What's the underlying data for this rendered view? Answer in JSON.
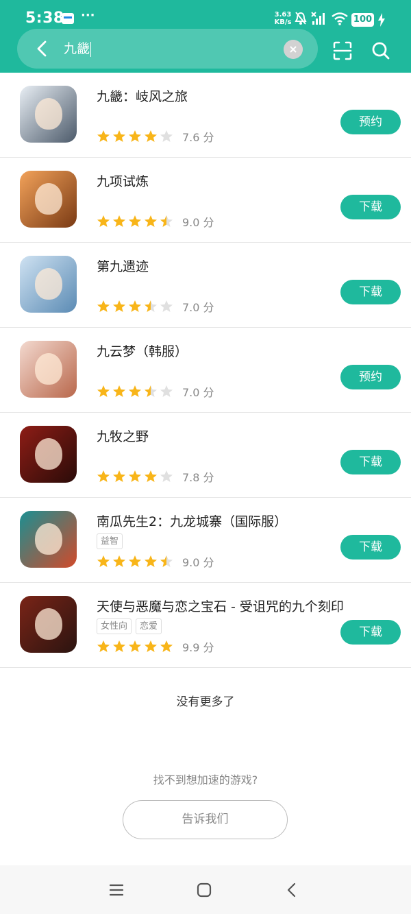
{
  "status_bar": {
    "time": "5:38",
    "more": "···",
    "net_speed_top": "3.63",
    "net_speed_bottom": "KB/s",
    "battery": "100"
  },
  "search": {
    "query": "九畿",
    "back_icon": "chevron-left-icon",
    "clear_icon": "clear-icon",
    "scan_icon": "scan-icon",
    "search_icon": "search-icon"
  },
  "results": [
    {
      "title": "九畿：岐风之旅",
      "tags": [],
      "stars": 4,
      "score": "7.6 分",
      "action": "预约",
      "icon_colors": [
        "#e8eef4",
        "#4c5a6a"
      ]
    },
    {
      "title": "九项试炼",
      "tags": [],
      "stars": 4.5,
      "score": "9.0 分",
      "action": "下载",
      "icon_colors": [
        "#f2a25a",
        "#7a3a14"
      ]
    },
    {
      "title": "第九遗迹",
      "tags": [],
      "stars": 3.5,
      "score": "7.0 分",
      "action": "下载",
      "icon_colors": [
        "#cfe2f2",
        "#5b8bb4"
      ]
    },
    {
      "title": "九云梦（韩服）",
      "tags": [],
      "stars": 3.5,
      "score": "7.0 分",
      "action": "预约",
      "icon_colors": [
        "#f3d9cf",
        "#b9684c"
      ]
    },
    {
      "title": "九牧之野",
      "tags": [],
      "stars": 4,
      "score": "7.8 分",
      "action": "下载",
      "icon_colors": [
        "#8e1d16",
        "#2a0b08"
      ]
    },
    {
      "title": "南瓜先生2：九龙城寨（国际服）",
      "tags": [
        "益智"
      ],
      "stars": 4.5,
      "score": "9.0 分",
      "action": "下载",
      "icon_colors": [
        "#1b8f92",
        "#d14a2a"
      ]
    },
    {
      "title": "天使与恶魔与恋之宝石 - 受诅咒的九个刻印",
      "tags": [
        "女性向",
        "恋爱"
      ],
      "stars": 5,
      "score": "9.9 分",
      "action": "下载",
      "icon_colors": [
        "#7a2417",
        "#2b1410"
      ]
    }
  ],
  "footer": {
    "no_more": "没有更多了",
    "cant_find": "找不到想加速的游戏?",
    "tell_us": "告诉我们"
  },
  "colors": {
    "accent": "#1fb99d",
    "star_filled": "#f8b519",
    "star_empty": "#e0e0e0"
  },
  "nav": {
    "menu_icon": "menu-icon",
    "home_icon": "home-icon",
    "back_icon": "back-icon"
  }
}
